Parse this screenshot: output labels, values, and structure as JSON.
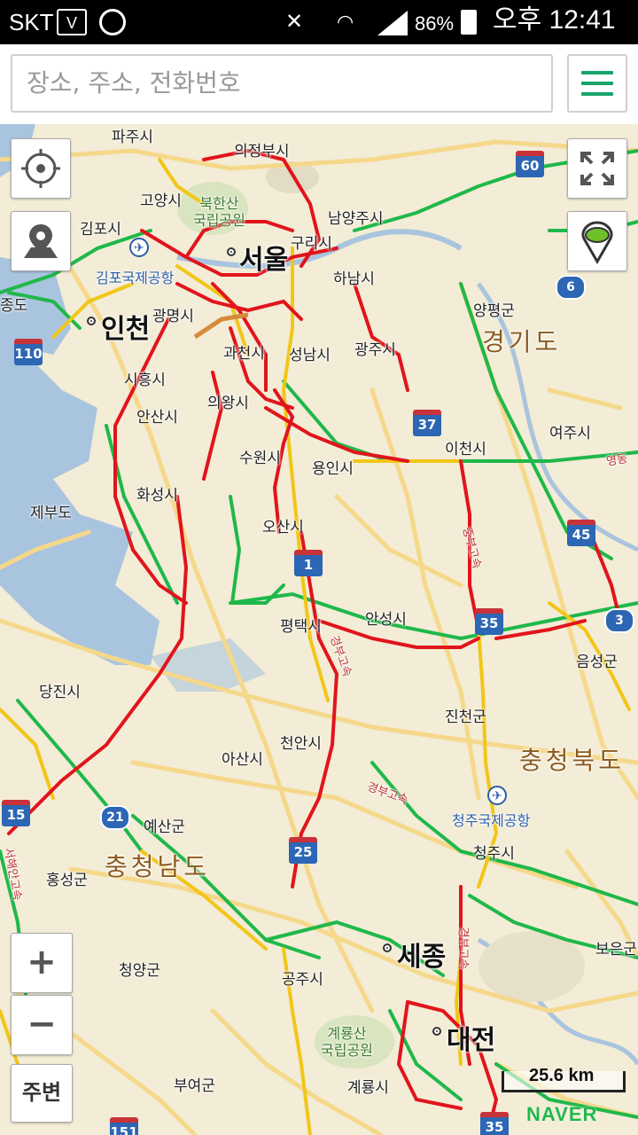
{
  "status_bar": {
    "carrier": "SKT",
    "battery": "86%",
    "time": "오후 12:41"
  },
  "search": {
    "placeholder": "장소, 주소, 전화번호"
  },
  "controls": {
    "zoom_in": "+",
    "zoom_out": "−",
    "nearby": "주변",
    "scale": "25.6 km",
    "brand": "NAVER"
  },
  "map": {
    "cities": {
      "paju": "파주시",
      "uijeongbu": "의정부시",
      "goyang": "고양시",
      "gimpo": "김포시",
      "bukhansan": "북한산\n국립공원",
      "namyangju": "남양주시",
      "guri": "구리시",
      "seoul": "서울",
      "gimpo_airport": "김포국제공항",
      "hanam": "하남시",
      "jongdo": "종도",
      "incheon": "인천",
      "gwangmyeong": "광명시",
      "yangpyeong": "양평군",
      "gyeonggi": "경기도",
      "gwacheon": "과천시",
      "seongnam": "성남시",
      "gwangju": "광주시",
      "siheung": "시흥시",
      "uiwang": "의왕시",
      "ansan": "안산시",
      "icheon": "이천시",
      "yeoju": "여주시",
      "suwon": "수원시",
      "yongin": "용인시",
      "hwaseong": "화성시",
      "jebudo": "제부도",
      "osan": "오산시",
      "pyeongtaek": "평택시",
      "anseong": "안성시",
      "eumseong": "음성군",
      "dangjin": "당진시",
      "jincheon": "진천군",
      "cheonan": "천안시",
      "asan": "아산시",
      "chungbuk": "충청북도",
      "cheongju_airport": "청주국제공항",
      "yesan": "예산군",
      "chungnam": "충청남도",
      "cheongju": "청주시",
      "hongseong": "홍성군",
      "boeun": "보은군",
      "sejong": "세종",
      "cheongyang": "청양군",
      "gongju": "공주시",
      "gyeryongsan": "계룡산\n국립공원",
      "daejeon": "대전",
      "buyeo": "부여군",
      "gyeryong": "계룡시"
    },
    "expressways": {
      "gyeongbu": "경부고속",
      "jungbu": "중부고속",
      "seohaean": "서해안고속",
      "yeongdong": "영동"
    },
    "routes": {
      "r60": "60",
      "r6": "6",
      "r110": "110",
      "r37": "37",
      "r1": "1",
      "r45": "45",
      "r35": "35",
      "r3": "3",
      "r15": "15",
      "r21": "21",
      "r25": "25",
      "r151": "151"
    },
    "colors": {
      "land": "#f3ecd6",
      "sea": "#a9c4de",
      "road_major": "#f5d88a",
      "traffic_free": "#1fb84a",
      "traffic_slow": "#f2c618",
      "traffic_jam": "#e1141c",
      "accent": "#16a46b"
    }
  }
}
